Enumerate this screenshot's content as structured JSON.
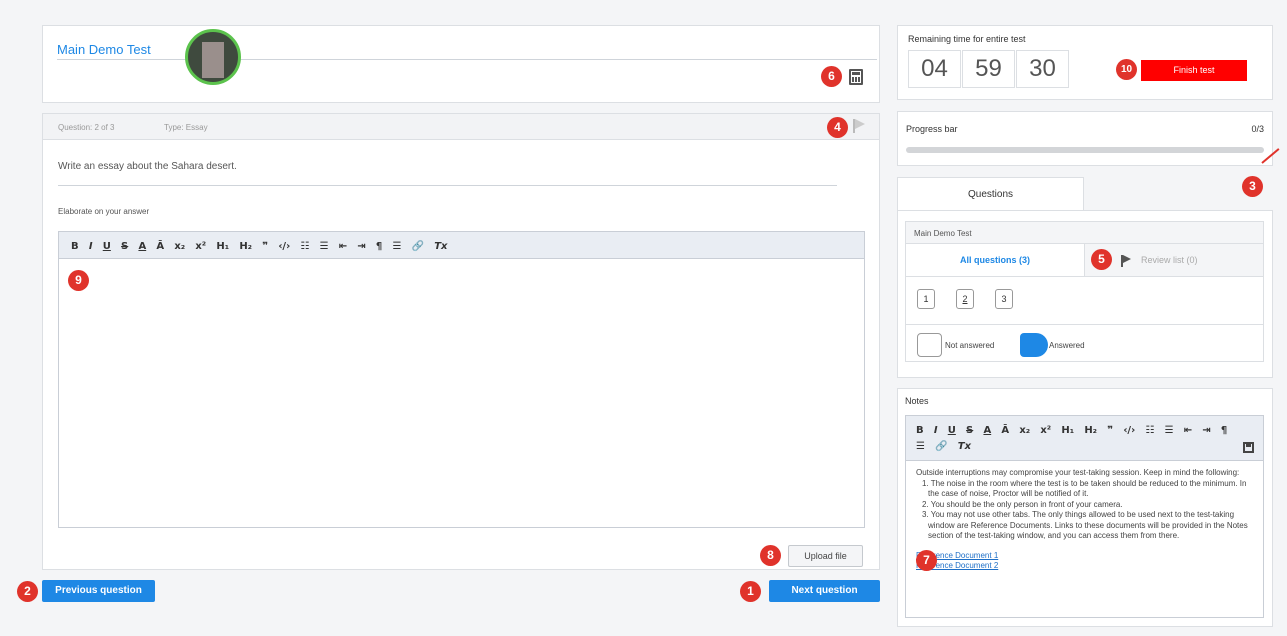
{
  "header": {
    "title": "Main Demo Test",
    "calculator_icon": "calculator-icon"
  },
  "question": {
    "number": "Question: 2 of 3",
    "type": "Type: Essay",
    "prompt": "Write an essay about the Sahara desert.",
    "elaborate_label": "Elaborate on your answer",
    "upload_label": "Upload file",
    "flag_icon": "flag-icon"
  },
  "editor_toolbar": [
    "B",
    "I",
    "U",
    "S",
    "A",
    "Ā",
    "x₂",
    "x²",
    "H₁",
    "H₂",
    "❞",
    "‹/›",
    "☷",
    "☰",
    "⇤",
    "⇥",
    "¶",
    "☰",
    "🔗",
    "Tx"
  ],
  "nav": {
    "previous_label": "Previous question",
    "next_label": "Next question"
  },
  "timer": {
    "label": "Remaining time for entire test",
    "hours": "04",
    "minutes": "59",
    "seconds": "30",
    "finish_label": "Finish test"
  },
  "progress": {
    "label": "Progress bar",
    "value_text": "0/3",
    "fraction": 0
  },
  "questions_panel": {
    "tab_label": "Questions",
    "test_name": "Main Demo Test",
    "all_label": "All questions (3)",
    "review_label": "Review list (0)",
    "numbers": [
      "1",
      "2",
      "3"
    ],
    "legend_not_answered": "Not answered",
    "legend_answered": "Answered"
  },
  "notes": {
    "label": "Notes",
    "intro": "Outside interruptions may compromise your test-taking session. Keep in mind the following:",
    "items": [
      "1. The noise in the room where the test is to be taken should be reduced to the minimum. In the case of noise, Proctor will be notified of it.",
      "2. You should be the only person in front of your camera.",
      "3. You may not use other tabs. The only things allowed to be used next to the test-taking window are Reference Documents. Links to these documents will be provided in the Notes section of the test-taking window, and you can access them from there."
    ],
    "link1": "Reference Document 1",
    "link2": "Reference Document 2"
  },
  "badges": [
    "1",
    "2",
    "3",
    "4",
    "5",
    "6",
    "7",
    "8",
    "9",
    "10"
  ],
  "colors": {
    "accent": "#1e88e5",
    "danger": "#ff0000",
    "badge": "#e0332b"
  }
}
